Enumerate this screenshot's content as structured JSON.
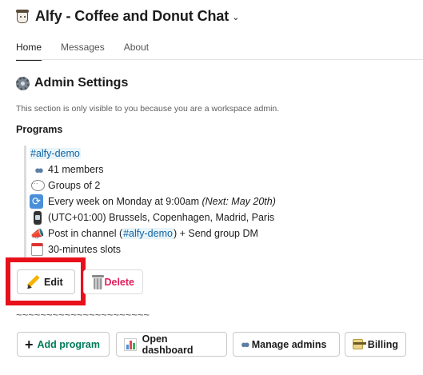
{
  "header": {
    "title": "Alfy - Coffee and Donut Chat",
    "caret": "⌄"
  },
  "tabs": [
    {
      "label": "Home",
      "active": true
    },
    {
      "label": "Messages",
      "active": false
    },
    {
      "label": "About",
      "active": false
    }
  ],
  "section": {
    "title": "Admin Settings",
    "notice": "This section is only visible to you because you are a workspace admin.",
    "programs_label": "Programs"
  },
  "program": {
    "channel": "#alfy-demo",
    "members": "41 members",
    "groups": "Groups of 2",
    "schedule": "Every week on Monday at 9:00am",
    "next": "(Next: May 20th)",
    "timezone": "(UTC+01:00) Brussels, Copenhagen, Madrid, Paris",
    "post_prefix": "Post in channel (",
    "post_channel": "#alfy-demo",
    "post_suffix": ") + Send group DM",
    "slots": "30-minutes slots"
  },
  "actions": {
    "edit_label": "Edit",
    "delete_label": "Delete"
  },
  "separator": "~~~~~~~~~~~~~~~~~~~~~~",
  "footer_buttons": {
    "add_program": "Add program",
    "open_dashboard": "Open dashboard",
    "manage_admins": "Manage admins",
    "billing": "Billing"
  },
  "colors": {
    "accent_green": "#007a5a",
    "delete_red": "#e01e5a",
    "link_blue": "#1264a3",
    "highlight_red": "#e8101b"
  },
  "icons": {
    "app": "coffee-cup-icon",
    "settings": "gear-icon",
    "members": "people-icon",
    "groups": "speech-bubble-icon",
    "schedule": "repeat-icon",
    "timezone": "watch-icon",
    "post": "megaphone-icon",
    "slots": "calendar-icon",
    "edit": "pencil-icon",
    "delete": "trash-icon",
    "add": "plus-icon",
    "dashboard": "bar-chart-icon",
    "admins": "people-icon",
    "billing": "credit-card-icon"
  }
}
